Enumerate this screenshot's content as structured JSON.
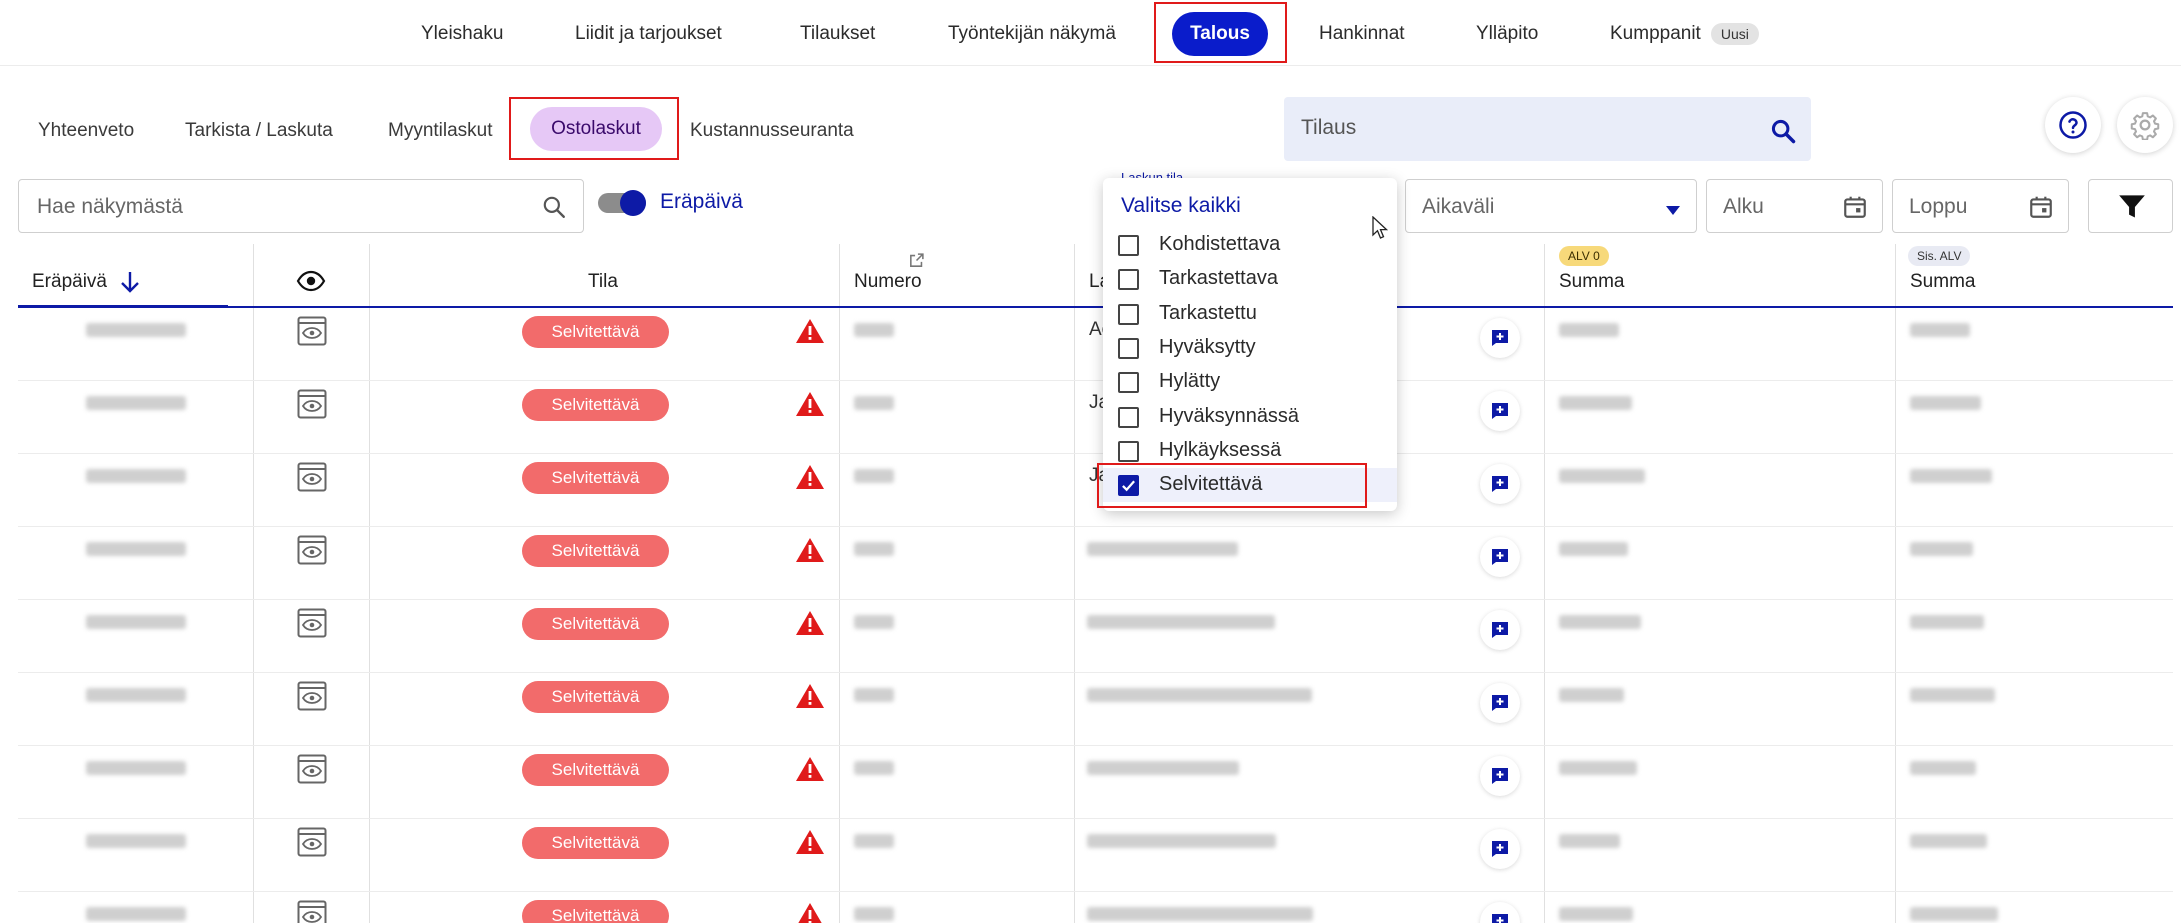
{
  "top_nav": {
    "items": [
      "Yleishaku",
      "Liidit ja tarjoukset",
      "Tilaukset",
      "Työntekijän näkymä",
      "Talous",
      "Hankinnat",
      "Ylläpito",
      "Kumppanit"
    ],
    "active": "Talous",
    "new_badge": "Uusi"
  },
  "sub_nav": {
    "items": [
      "Yhteenveto",
      "Tarkista / Laskuta",
      "Myyntilaskut",
      "Ostolaskut",
      "Kustannusseuranta"
    ],
    "active": "Ostolaskut"
  },
  "order_search": {
    "placeholder": "Tilaus"
  },
  "filters": {
    "view_search_placeholder": "Hae näkymästä",
    "due_date_toggle_label": "Eräpäivä",
    "due_date_toggle_on": true,
    "status_field_label": "Laskun tila",
    "period_placeholder": "Aikaväli",
    "start_placeholder": "Alku",
    "end_placeholder": "Loppu"
  },
  "status_dropdown": {
    "select_all": "Valitse kaikki",
    "options": [
      {
        "label": "Kohdistettava",
        "checked": false
      },
      {
        "label": "Tarkastettava",
        "checked": false
      },
      {
        "label": "Tarkastettu",
        "checked": false
      },
      {
        "label": "Hyväksytty",
        "checked": false
      },
      {
        "label": "Hylätty",
        "checked": false
      },
      {
        "label": "Hyväksynnässä",
        "checked": false
      },
      {
        "label": "Hylkäyksessä",
        "checked": false
      },
      {
        "label": "Selvitettävä",
        "checked": true
      }
    ]
  },
  "table": {
    "columns": {
      "due_date": "Eräpäivä",
      "status": "Tila",
      "number": "Numero",
      "supplier_partial": "La",
      "sum_excl": "Summa",
      "sum_incl": "Summa"
    },
    "badges": {
      "excl_vat": "ALV 0",
      "incl_vat": "Sis. ALV"
    },
    "rows": [
      {
        "status": "Selvitettävä",
        "supplier_partial": "Ac"
      },
      {
        "status": "Selvitettävä",
        "supplier_partial": "Ja"
      },
      {
        "status": "Selvitettävä",
        "supplier_partial": "Ja"
      },
      {
        "status": "Selvitettävä",
        "supplier_partial": ""
      },
      {
        "status": "Selvitettävä",
        "supplier_partial": ""
      },
      {
        "status": "Selvitettävä",
        "supplier_partial": ""
      },
      {
        "status": "Selvitettävä",
        "supplier_partial": ""
      },
      {
        "status": "Selvitettävä",
        "supplier_partial": ""
      },
      {
        "status": "Selvitettävä",
        "supplier_partial": ""
      }
    ]
  },
  "colors": {
    "primary": "#0d1aa6",
    "active_pill": "#0a1ccb",
    "sub_active": "#e6c8f6",
    "status_red": "#f26b6b",
    "warning": "#e01a1a",
    "highlight_outline": "#e01a1a"
  }
}
